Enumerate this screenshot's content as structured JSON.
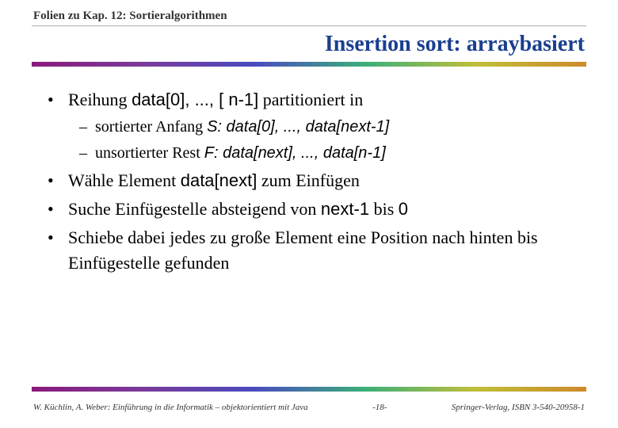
{
  "header": {
    "label": "Folien zu Kap. 12: Sortieralgorithmen"
  },
  "title": "Insertion sort: arraybasiert",
  "bullets": {
    "b1_pre": "Reihung ",
    "b1_code": "data[0], ..., [ n-1]",
    "b1_post": "  partitioniert in",
    "s1_pre": "sortierter Anfang  ",
    "s1_code": "S:  data[0], ..., data[next-1]",
    "s2_pre": "unsortierter Rest  ",
    "s2_code": "F:  data[next], ..., data[n-1]",
    "b2_pre": "Wähle Element ",
    "b2_code": "data[next]",
    "b2_post": " zum Einfügen",
    "b3_pre": "Suche Einfügestelle absteigend von  ",
    "b3_code1": "next-1",
    "b3_mid": "  bis  ",
    "b3_code2": "0",
    "b4": "Schiebe dabei jedes zu große Element eine Position nach hinten bis Einfügestelle gefunden"
  },
  "footer": {
    "left": "W. Küchlin, A. Weber: Einführung in die Informatik – objektorientiert mit Java",
    "page": "-18-",
    "right": "Springer-Verlag, ISBN 3-540-20958-1"
  }
}
